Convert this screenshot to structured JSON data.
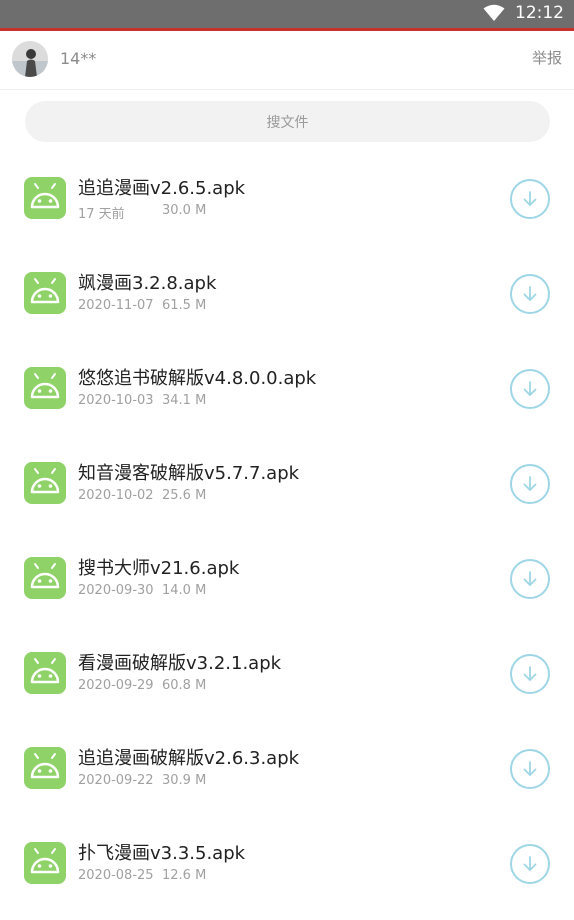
{
  "status_bar": {
    "time": "12:12",
    "icons": [
      "wifi-icon"
    ]
  },
  "header": {
    "username": "14**",
    "report_label": "举报"
  },
  "search": {
    "placeholder": "搜文件"
  },
  "files": [
    {
      "name": "追追漫画v2.6.5.apk",
      "date": "17 天前",
      "size": "30.0 M"
    },
    {
      "name": "飒漫画3.2.8.apk",
      "date": "2020-11-07",
      "size": "61.5 M"
    },
    {
      "name": "悠悠追书破解版v4.8.0.0.apk",
      "date": "2020-10-03",
      "size": "34.1 M"
    },
    {
      "name": "知音漫客破解版v5.7.7.apk",
      "date": "2020-10-02",
      "size": "25.6 M"
    },
    {
      "name": "搜书大师v21.6.apk",
      "date": "2020-09-30",
      "size": "14.0 M"
    },
    {
      "name": "看漫画破解版v3.2.1.apk",
      "date": "2020-09-29",
      "size": "60.8 M"
    },
    {
      "name": "追追漫画破解版v2.6.3.apk",
      "date": "2020-09-22",
      "size": "30.9 M"
    },
    {
      "name": "扑飞漫画v3.3.5.apk",
      "date": "2020-08-25",
      "size": "12.6 M"
    }
  ],
  "colors": {
    "status_bar": "#6e6e6e",
    "accent_line": "#c8302c",
    "apk_icon": "#8ed268",
    "download_ring": "#9fd6e6"
  }
}
